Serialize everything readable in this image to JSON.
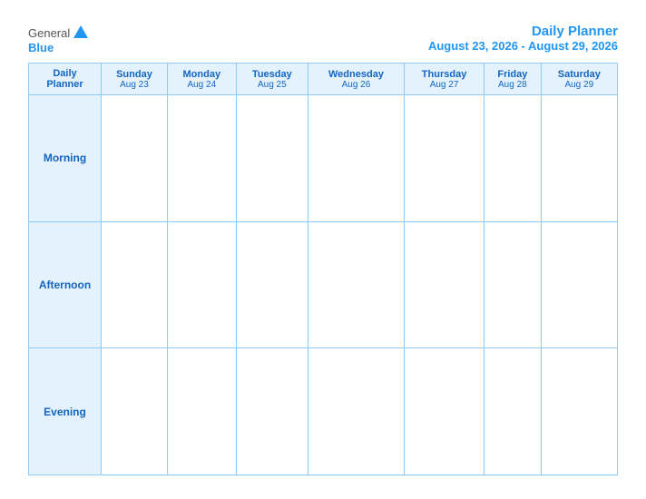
{
  "header": {
    "logo": {
      "general": "General",
      "blue": "Blue"
    },
    "title": "Daily Planner",
    "date_range": "August 23, 2026 - August 29, 2026"
  },
  "table": {
    "corner_header_line1": "Daily",
    "corner_header_line2": "Planner",
    "days": [
      {
        "name": "Sunday",
        "date": "Aug 23"
      },
      {
        "name": "Monday",
        "date": "Aug 24"
      },
      {
        "name": "Tuesday",
        "date": "Aug 25"
      },
      {
        "name": "Wednesday",
        "date": "Aug 26"
      },
      {
        "name": "Thursday",
        "date": "Aug 27"
      },
      {
        "name": "Friday",
        "date": "Aug 28"
      },
      {
        "name": "Saturday",
        "date": "Aug 29"
      }
    ],
    "rows": [
      {
        "label": "Morning"
      },
      {
        "label": "Afternoon"
      },
      {
        "label": "Evening"
      }
    ]
  }
}
